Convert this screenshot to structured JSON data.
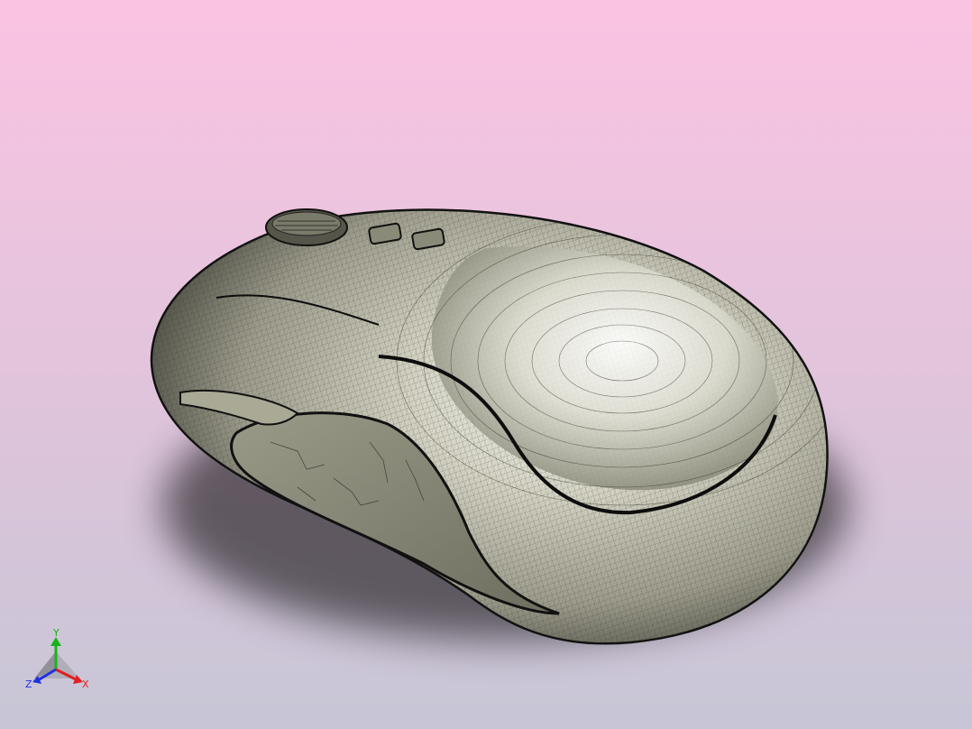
{
  "viewport": {
    "background_top": "#fbc3e2",
    "background_mid": "#e2c4dc",
    "background_bottom": "#c7c6d6"
  },
  "model": {
    "name": "wireless-mouse",
    "shell_color": "#b9b8a8",
    "shell_highlight": "#f2f2ec",
    "edge_color": "#1a1a1a",
    "side_grip_color": "#8a8a78"
  },
  "triad": {
    "axes": {
      "x": {
        "label": "X",
        "color": "#e02020"
      },
      "y": {
        "label": "Y",
        "color": "#19b319"
      },
      "z": {
        "label": "Z",
        "color": "#2030e0"
      }
    }
  }
}
